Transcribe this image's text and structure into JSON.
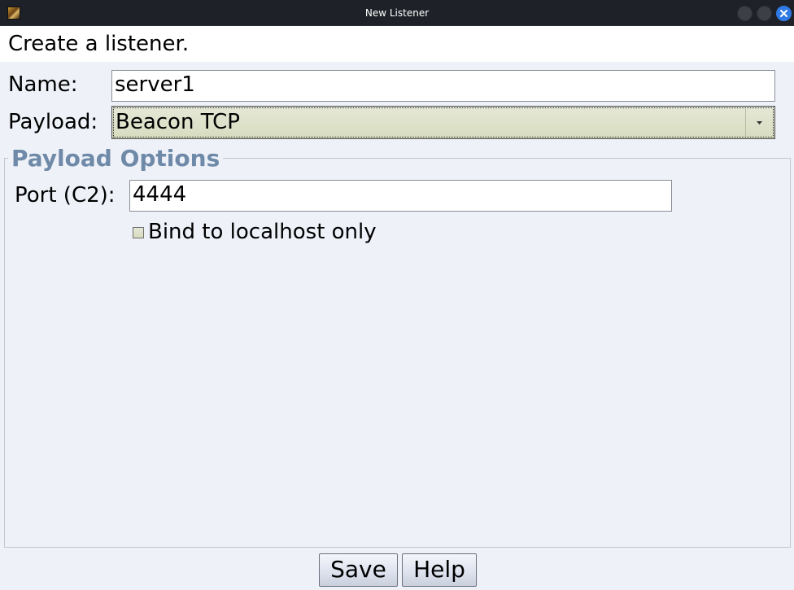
{
  "window": {
    "title": "New Listener",
    "icon": "app-icon",
    "buttons": [
      "minimize-icon",
      "maximize-icon",
      "close-icon"
    ]
  },
  "header": {
    "text": "Create a listener."
  },
  "form": {
    "name_label": "Name:",
    "name_value": "server1",
    "payload_label": "Payload:",
    "payload_value": "Beacon TCP"
  },
  "payload_options": {
    "title": "Payload Options",
    "port_label": "Port (C2):",
    "port_value": "4444",
    "bind_label": "Bind to localhost only",
    "bind_checked": false
  },
  "footer": {
    "save_label": "Save",
    "help_label": "Help"
  },
  "colors": {
    "titlebar": "#1e2127",
    "close_button": "#2f7ae5",
    "group_title": "#6f8aa8",
    "combo_fill": "#d6dcbf"
  }
}
